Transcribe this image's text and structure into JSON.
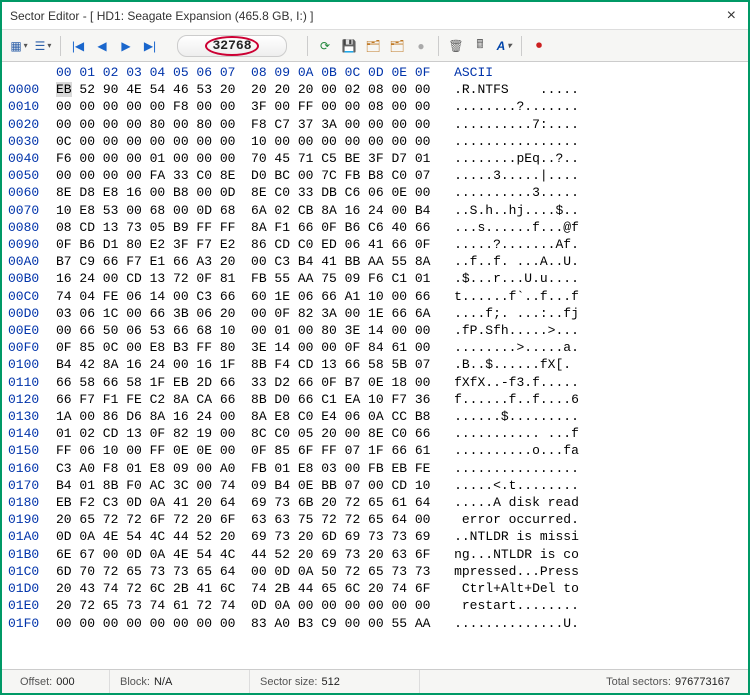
{
  "window": {
    "title": "Sector Editor - [ HD1: Seagate Expansion (465.8 GB, I:) ]",
    "close": "×"
  },
  "toolbar": {
    "icons": [
      "topbox",
      "listbox",
      "first",
      "prev",
      "next",
      "last",
      "go",
      "ref1",
      "ref2",
      "disk1",
      "disk2",
      "gray",
      "trash",
      "calc",
      "font",
      "rec"
    ],
    "sector_value": "32768"
  },
  "hex": {
    "col_header": [
      "00",
      "01",
      "02",
      "03",
      "04",
      "05",
      "06",
      "07",
      "08",
      "09",
      "0A",
      "0B",
      "0C",
      "0D",
      "0E",
      "0F"
    ],
    "ascii_label": "ASCII",
    "rows": [
      {
        "o": "0000",
        "b": [
          "EB",
          "52",
          "90",
          "4E",
          "54",
          "46",
          "53",
          "20",
          "20",
          "20",
          "20",
          "00",
          "02",
          "08",
          "00",
          "00"
        ],
        "a": ".R.NTFS    ....."
      },
      {
        "o": "0010",
        "b": [
          "00",
          "00",
          "00",
          "00",
          "00",
          "F8",
          "00",
          "00",
          "3F",
          "00",
          "FF",
          "00",
          "00",
          "08",
          "00",
          "00"
        ],
        "a": "........?......."
      },
      {
        "o": "0020",
        "b": [
          "00",
          "00",
          "00",
          "00",
          "80",
          "00",
          "80",
          "00",
          "F8",
          "C7",
          "37",
          "3A",
          "00",
          "00",
          "00",
          "00"
        ],
        "a": "..........7:...."
      },
      {
        "o": "0030",
        "b": [
          "0C",
          "00",
          "00",
          "00",
          "00",
          "00",
          "00",
          "00",
          "10",
          "00",
          "00",
          "00",
          "00",
          "00",
          "00",
          "00"
        ],
        "a": "................"
      },
      {
        "o": "0040",
        "b": [
          "F6",
          "00",
          "00",
          "00",
          "01",
          "00",
          "00",
          "00",
          "70",
          "45",
          "71",
          "C5",
          "BE",
          "3F",
          "D7",
          "01"
        ],
        "a": "........pEq..?.."
      },
      {
        "o": "0050",
        "b": [
          "00",
          "00",
          "00",
          "00",
          "FA",
          "33",
          "C0",
          "8E",
          "D0",
          "BC",
          "00",
          "7C",
          "FB",
          "B8",
          "C0",
          "07"
        ],
        "a": ".....3.....|...."
      },
      {
        "o": "0060",
        "b": [
          "8E",
          "D8",
          "E8",
          "16",
          "00",
          "B8",
          "00",
          "0D",
          "8E",
          "C0",
          "33",
          "DB",
          "C6",
          "06",
          "0E",
          "00"
        ],
        "a": "..........3....."
      },
      {
        "o": "0070",
        "b": [
          "10",
          "E8",
          "53",
          "00",
          "68",
          "00",
          "0D",
          "68",
          "6A",
          "02",
          "CB",
          "8A",
          "16",
          "24",
          "00",
          "B4"
        ],
        "a": "..S.h..hj....$.."
      },
      {
        "o": "0080",
        "b": [
          "08",
          "CD",
          "13",
          "73",
          "05",
          "B9",
          "FF",
          "FF",
          "8A",
          "F1",
          "66",
          "0F",
          "B6",
          "C6",
          "40",
          "66"
        ],
        "a": "...s......f...@f"
      },
      {
        "o": "0090",
        "b": [
          "0F",
          "B6",
          "D1",
          "80",
          "E2",
          "3F",
          "F7",
          "E2",
          "86",
          "CD",
          "C0",
          "ED",
          "06",
          "41",
          "66",
          "0F"
        ],
        "a": ".....?.......Af."
      },
      {
        "o": "00A0",
        "b": [
          "B7",
          "C9",
          "66",
          "F7",
          "E1",
          "66",
          "A3",
          "20",
          "00",
          "C3",
          "B4",
          "41",
          "BB",
          "AA",
          "55",
          "8A"
        ],
        "a": "..f..f. ...A..U."
      },
      {
        "o": "00B0",
        "b": [
          "16",
          "24",
          "00",
          "CD",
          "13",
          "72",
          "0F",
          "81",
          "FB",
          "55",
          "AA",
          "75",
          "09",
          "F6",
          "C1",
          "01"
        ],
        "a": ".$...r...U.u...."
      },
      {
        "o": "00C0",
        "b": [
          "74",
          "04",
          "FE",
          "06",
          "14",
          "00",
          "C3",
          "66",
          "60",
          "1E",
          "06",
          "66",
          "A1",
          "10",
          "00",
          "66"
        ],
        "a": "t......f`..f...f"
      },
      {
        "o": "00D0",
        "b": [
          "03",
          "06",
          "1C",
          "00",
          "66",
          "3B",
          "06",
          "20",
          "00",
          "0F",
          "82",
          "3A",
          "00",
          "1E",
          "66",
          "6A"
        ],
        "a": "....f;. ...:..fj"
      },
      {
        "o": "00E0",
        "b": [
          "00",
          "66",
          "50",
          "06",
          "53",
          "66",
          "68",
          "10",
          "00",
          "01",
          "00",
          "80",
          "3E",
          "14",
          "00",
          "00"
        ],
        "a": ".fP.Sfh.....>..."
      },
      {
        "o": "00F0",
        "b": [
          "0F",
          "85",
          "0C",
          "00",
          "E8",
          "B3",
          "FF",
          "80",
          "3E",
          "14",
          "00",
          "00",
          "0F",
          "84",
          "61",
          "00"
        ],
        "a": "........>.....a."
      },
      {
        "o": "0100",
        "b": [
          "B4",
          "42",
          "8A",
          "16",
          "24",
          "00",
          "16",
          "1F",
          "8B",
          "F4",
          "CD",
          "13",
          "66",
          "58",
          "5B",
          "07"
        ],
        "a": ".B..$......fX[."
      },
      {
        "o": "0110",
        "b": [
          "66",
          "58",
          "66",
          "58",
          "1F",
          "EB",
          "2D",
          "66",
          "33",
          "D2",
          "66",
          "0F",
          "B7",
          "0E",
          "18",
          "00"
        ],
        "a": "fXfX..-f3.f....."
      },
      {
        "o": "0120",
        "b": [
          "66",
          "F7",
          "F1",
          "FE",
          "C2",
          "8A",
          "CA",
          "66",
          "8B",
          "D0",
          "66",
          "C1",
          "EA",
          "10",
          "F7",
          "36"
        ],
        "a": "f......f..f....6"
      },
      {
        "o": "0130",
        "b": [
          "1A",
          "00",
          "86",
          "D6",
          "8A",
          "16",
          "24",
          "00",
          "8A",
          "E8",
          "C0",
          "E4",
          "06",
          "0A",
          "CC",
          "B8"
        ],
        "a": "......$........."
      },
      {
        "o": "0140",
        "b": [
          "01",
          "02",
          "CD",
          "13",
          "0F",
          "82",
          "19",
          "00",
          "8C",
          "C0",
          "05",
          "20",
          "00",
          "8E",
          "C0",
          "66"
        ],
        "a": "........... ...f"
      },
      {
        "o": "0150",
        "b": [
          "FF",
          "06",
          "10",
          "00",
          "FF",
          "0E",
          "0E",
          "00",
          "0F",
          "85",
          "6F",
          "FF",
          "07",
          "1F",
          "66",
          "61"
        ],
        "a": "..........o...fa"
      },
      {
        "o": "0160",
        "b": [
          "C3",
          "A0",
          "F8",
          "01",
          "E8",
          "09",
          "00",
          "A0",
          "FB",
          "01",
          "E8",
          "03",
          "00",
          "FB",
          "EB",
          "FE"
        ],
        "a": "................"
      },
      {
        "o": "0170",
        "b": [
          "B4",
          "01",
          "8B",
          "F0",
          "AC",
          "3C",
          "00",
          "74",
          "09",
          "B4",
          "0E",
          "BB",
          "07",
          "00",
          "CD",
          "10"
        ],
        "a": ".....<.t........"
      },
      {
        "o": "0180",
        "b": [
          "EB",
          "F2",
          "C3",
          "0D",
          "0A",
          "41",
          "20",
          "64",
          "69",
          "73",
          "6B",
          "20",
          "72",
          "65",
          "61",
          "64"
        ],
        "a": ".....A disk read"
      },
      {
        "o": "0190",
        "b": [
          "20",
          "65",
          "72",
          "72",
          "6F",
          "72",
          "20",
          "6F",
          "63",
          "63",
          "75",
          "72",
          "72",
          "65",
          "64",
          "00"
        ],
        "a": " error occurred."
      },
      {
        "o": "01A0",
        "b": [
          "0D",
          "0A",
          "4E",
          "54",
          "4C",
          "44",
          "52",
          "20",
          "69",
          "73",
          "20",
          "6D",
          "69",
          "73",
          "73",
          "69"
        ],
        "a": "..NTLDR is missi"
      },
      {
        "o": "01B0",
        "b": [
          "6E",
          "67",
          "00",
          "0D",
          "0A",
          "4E",
          "54",
          "4C",
          "44",
          "52",
          "20",
          "69",
          "73",
          "20",
          "63",
          "6F"
        ],
        "a": "ng...NTLDR is co"
      },
      {
        "o": "01C0",
        "b": [
          "6D",
          "70",
          "72",
          "65",
          "73",
          "73",
          "65",
          "64",
          "00",
          "0D",
          "0A",
          "50",
          "72",
          "65",
          "73",
          "73"
        ],
        "a": "mpressed...Press"
      },
      {
        "o": "01D0",
        "b": [
          "20",
          "43",
          "74",
          "72",
          "6C",
          "2B",
          "41",
          "6C",
          "74",
          "2B",
          "44",
          "65",
          "6C",
          "20",
          "74",
          "6F"
        ],
        "a": " Ctrl+Alt+Del to"
      },
      {
        "o": "01E0",
        "b": [
          "20",
          "72",
          "65",
          "73",
          "74",
          "61",
          "72",
          "74",
          "0D",
          "0A",
          "00",
          "00",
          "00",
          "00",
          "00",
          "00"
        ],
        "a": " restart........"
      },
      {
        "o": "01F0",
        "b": [
          "00",
          "00",
          "00",
          "00",
          "00",
          "00",
          "00",
          "00",
          "83",
          "A0",
          "B3",
          "C9",
          "00",
          "00",
          "55",
          "AA"
        ],
        "a": "..............U."
      }
    ]
  },
  "status": {
    "offset_label": "Offset:",
    "offset_value": "000",
    "block_label": "Block:",
    "block_value": "N/A",
    "sector_label": "Sector size:",
    "sector_value": "512",
    "total_label": "Total sectors:",
    "total_value": "976773167"
  }
}
